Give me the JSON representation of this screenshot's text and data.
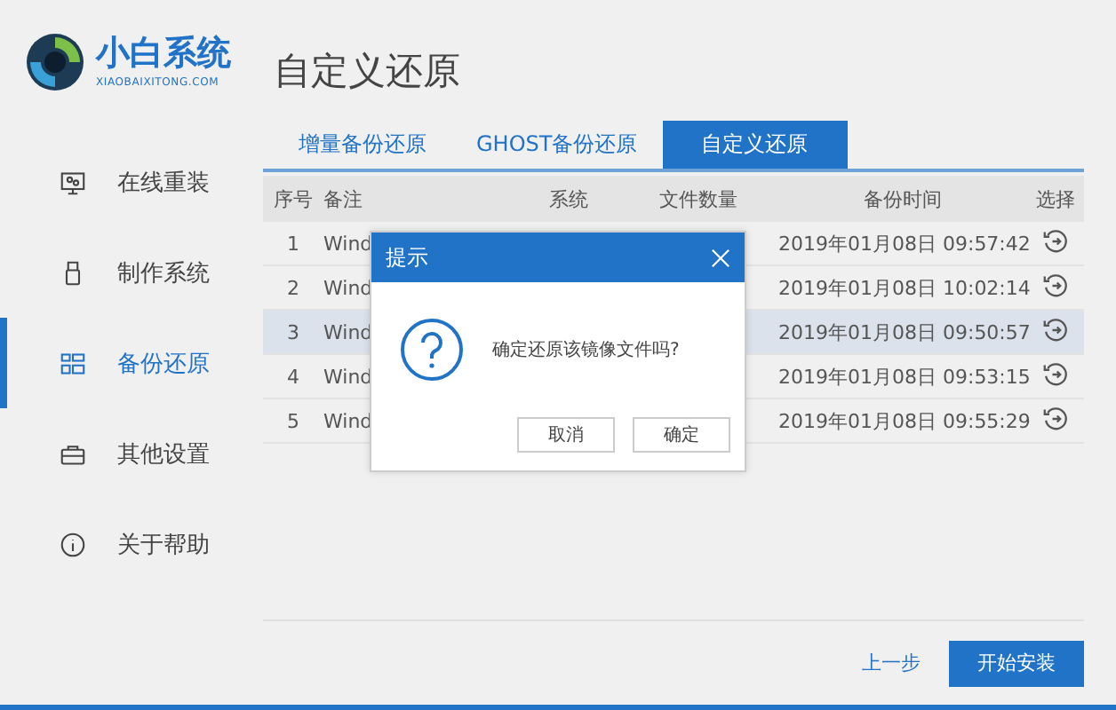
{
  "logo": {
    "name": "小白系统",
    "site": "XIAOBAIXITONG.COM"
  },
  "sidebar": {
    "items": [
      {
        "label": "在线重装",
        "selected": false
      },
      {
        "label": "制作系统",
        "selected": false
      },
      {
        "label": "备份还原",
        "selected": true
      },
      {
        "label": "其他设置",
        "selected": false
      },
      {
        "label": "关于帮助",
        "selected": false
      }
    ]
  },
  "page_title": "自定义还原",
  "tabs": [
    {
      "label": "增量备份还原",
      "selected": false
    },
    {
      "label": "GHOST备份还原",
      "selected": false
    },
    {
      "label": "自定义还原",
      "selected": true
    }
  ],
  "table": {
    "columns": [
      "序号",
      "备注",
      "系统",
      "文件数量",
      "备份时间",
      "选择"
    ],
    "rows": [
      {
        "index": "1",
        "note": "Wind",
        "time": "2019年01月08日 09:57:42",
        "selected": false
      },
      {
        "index": "2",
        "note": "Wind",
        "time": "2019年01月08日 10:02:14",
        "selected": false
      },
      {
        "index": "3",
        "note": "Wind",
        "time": "2019年01月08日 09:50:57",
        "selected": true
      },
      {
        "index": "4",
        "note": "Wind",
        "time": "2019年01月08日 09:53:15",
        "selected": false
      },
      {
        "index": "5",
        "note": "Wind",
        "time": "2019年01月08日 09:55:29",
        "selected": false
      }
    ]
  },
  "dialog": {
    "title": "提示",
    "message": "确定还原该镜像文件吗?",
    "buttons": [
      "取消",
      "确定"
    ]
  },
  "footer": {
    "back": "上一步",
    "primary": "开始安装"
  }
}
